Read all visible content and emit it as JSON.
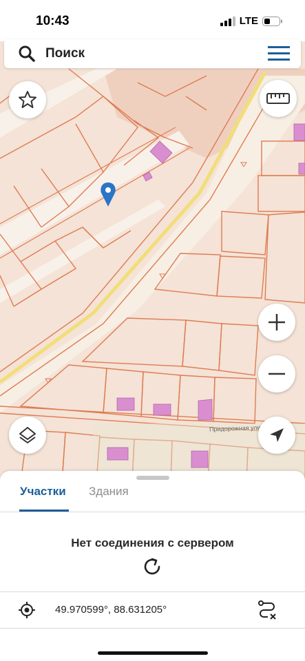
{
  "status": {
    "time": "10:43",
    "network": "LTE"
  },
  "search": {
    "placeholder": "Поиск"
  },
  "map": {
    "street_label": "Придорожная улица"
  },
  "icons": {
    "search": "search-icon",
    "menu": "hamburger-menu-icon",
    "favorite": "star-icon",
    "ruler": "ruler-icon",
    "zoom_in": "plus-icon",
    "zoom_out": "minus-icon",
    "layers": "layers-icon",
    "locate": "navigation-arrow-icon",
    "marker": "map-pin-icon",
    "refresh": "refresh-icon",
    "target": "crosshair-icon",
    "route": "route-clear-icon"
  },
  "colors": {
    "accent": "#1d5d97",
    "map_bg": "#f4e3d6",
    "parcel_line": "#e07a52",
    "building": "#d98fcf",
    "road": "#f7efe3",
    "road_line": "#f2de78",
    "marker": "#2b74c8"
  },
  "sheet": {
    "tabs": [
      {
        "label": "Участки",
        "active": true
      },
      {
        "label": "Здания",
        "active": false
      }
    ],
    "error_message": "Нет соединения с сервером",
    "coordinates": "49.970599°, 88.631205°"
  }
}
